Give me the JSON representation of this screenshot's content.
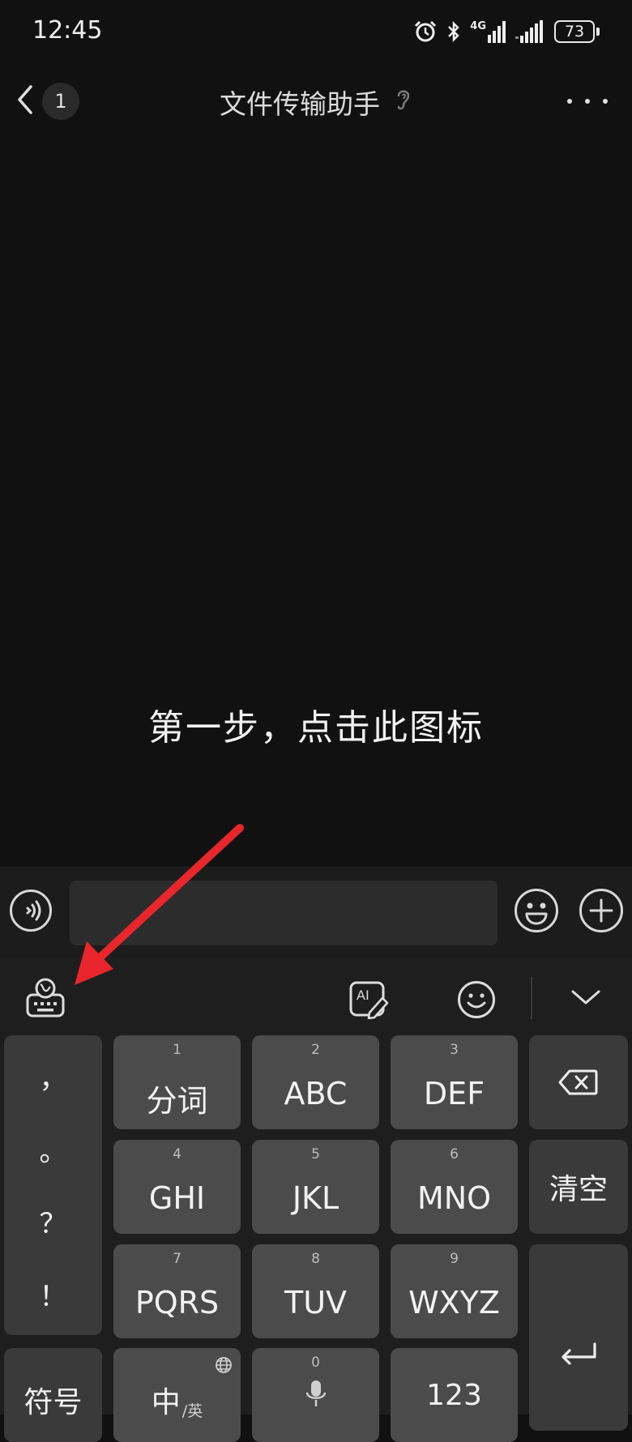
{
  "status_bar": {
    "time": "12:45",
    "network_label": "4G",
    "battery_level": "73",
    "icons": [
      "alarm-icon",
      "bluetooth-icon",
      "signal-4g-icon",
      "signal-icon",
      "battery-icon"
    ]
  },
  "header": {
    "unread_count": "1",
    "title": "文件传输助手",
    "icons": [
      "chevron-left-icon",
      "ear-icon",
      "more-icon"
    ]
  },
  "chat": {
    "caption": "第一步，点击此图标"
  },
  "input_bar": {
    "placeholder": "",
    "value": "",
    "icons": [
      "voice-icon",
      "emoji-icon",
      "plus-icon"
    ]
  },
  "keyboard": {
    "toolbar_icons": [
      "keyboard-globe-icon",
      "ai-pen-icon",
      "smile-icon",
      "chevron-down-icon"
    ],
    "punctuation": [
      "，",
      "。",
      "？",
      "！"
    ],
    "rows": [
      [
        {
          "num": "1",
          "label": "分词"
        },
        {
          "num": "2",
          "label": "ABC"
        },
        {
          "num": "3",
          "label": "DEF"
        }
      ],
      [
        {
          "num": "4",
          "label": "GHI"
        },
        {
          "num": "5",
          "label": "JKL"
        },
        {
          "num": "6",
          "label": "MNO"
        }
      ],
      [
        {
          "num": "7",
          "label": "PQRS"
        },
        {
          "num": "8",
          "label": "TUV"
        },
        {
          "num": "9",
          "label": "WXYZ"
        }
      ]
    ],
    "clear_label": "清空",
    "symbols_label": "符号",
    "lang_main": "中",
    "lang_sub": "/英",
    "zero_num": "0",
    "numbers_label": "123"
  },
  "colors": {
    "background": "#111111",
    "key": "#4b4b4b",
    "arrow": "#e8262b"
  }
}
